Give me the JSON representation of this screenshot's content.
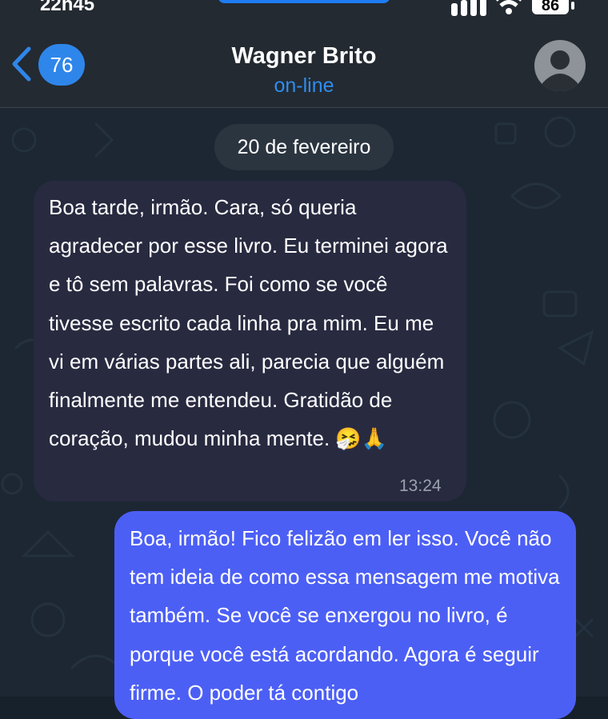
{
  "status_bar": {
    "time": "22h45",
    "battery": "86"
  },
  "header": {
    "unread_count": "76",
    "contact_name": "Wagner Brito",
    "contact_status": "on-line"
  },
  "chat": {
    "date_separator": "20 de fevereiro",
    "messages": [
      {
        "direction": "incoming",
        "text": "Boa tarde, irmão. Cara, só queria agradecer por esse livro. Eu terminei agora e tô sem palavras. Foi como se você tivesse escrito cada linha pra mim. Eu me vi em várias partes ali, parecia que alguém finalmente me entendeu. Gratidão de coração, mudou minha mente. 🤧🙏",
        "time": "13:24"
      },
      {
        "direction": "outgoing",
        "text": "Boa, irmão! Fico felizão em ler isso. Você não tem ideia de como essa mensagem me motiva também. Se você se enxergou no livro, é porque você está acordando. Agora é seguir firme. O poder tá contigo"
      }
    ]
  },
  "colors": {
    "header_bg": "#232a31",
    "chat_bg": "#1c2733",
    "incoming_bubble": "#282a40",
    "outgoing_bubble": "#4c5ff5",
    "accent": "#2f86ea"
  }
}
